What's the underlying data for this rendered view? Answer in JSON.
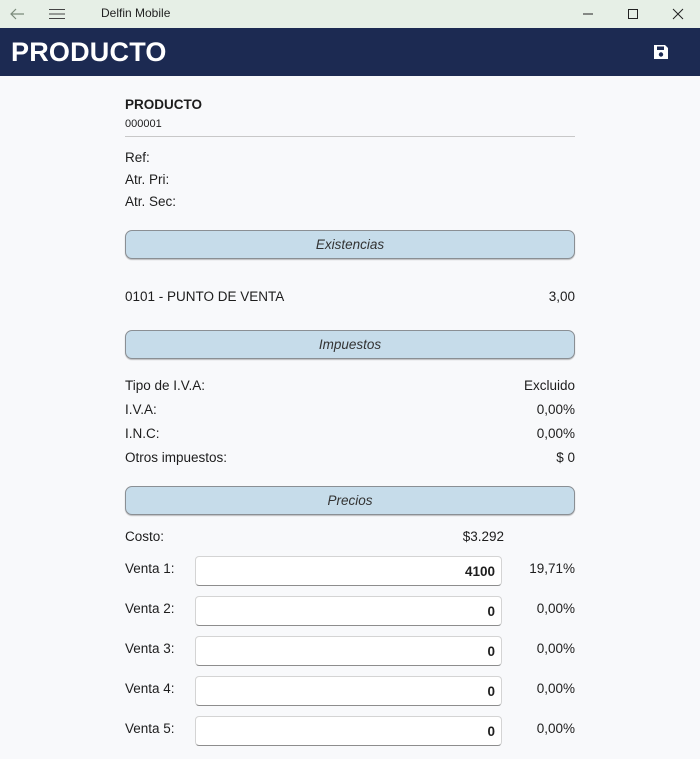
{
  "window": {
    "title": "Delfin Mobile"
  },
  "header": {
    "title": "PRODUCTO"
  },
  "product": {
    "name": "PRODUCTO",
    "code": "000001",
    "ref_label": "Ref:",
    "atr_pri_label": "Atr. Pri:",
    "atr_sec_label": "Atr. Sec:"
  },
  "existencias": {
    "section_label": "Existencias",
    "rows": [
      {
        "location": "0101 - PUNTO DE VENTA",
        "quantity": "3,00"
      }
    ]
  },
  "impuestos": {
    "section_label": "Impuestos",
    "rows": [
      {
        "label": "Tipo de I.V.A:",
        "value": "Excluido"
      },
      {
        "label": "I.V.A:",
        "value": "0,00%"
      },
      {
        "label": "I.N.C:",
        "value": "0,00%"
      },
      {
        "label": "Otros impuestos:",
        "value": "$ 0"
      }
    ]
  },
  "precios": {
    "section_label": "Precios",
    "costo_label": "Costo:",
    "costo_value": "$3.292",
    "ventas": [
      {
        "label": "Venta 1:",
        "value": "4100",
        "percent": "19,71%"
      },
      {
        "label": "Venta 2:",
        "value": "0",
        "percent": "0,00%"
      },
      {
        "label": "Venta 3:",
        "value": "0",
        "percent": "0,00%"
      },
      {
        "label": "Venta 4:",
        "value": "0",
        "percent": "0,00%"
      },
      {
        "label": "Venta 5:",
        "value": "0",
        "percent": "0,00%"
      }
    ]
  },
  "icons": {
    "back": "back-arrow-icon",
    "menu": "hamburger-menu-icon",
    "minimize": "minimize-icon",
    "maximize": "maximize-icon",
    "close": "close-icon",
    "save": "save-icon"
  },
  "colors": {
    "header_bg": "#1c2a52",
    "titlebar_bg": "#e6efe6",
    "section_bg": "#c6dcea",
    "page_bg": "#f8f9fb"
  }
}
